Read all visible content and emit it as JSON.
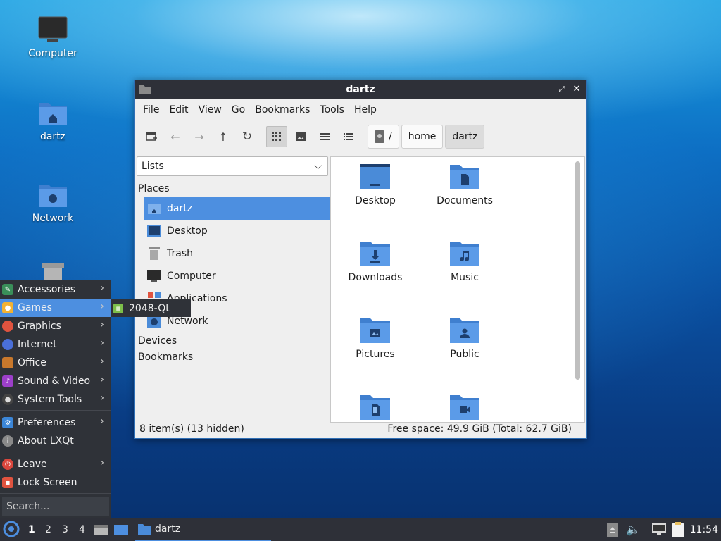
{
  "desktop": {
    "icons": [
      {
        "label": "Computer",
        "icon": "computer-icon"
      },
      {
        "label": "dartz",
        "icon": "home-folder-icon"
      },
      {
        "label": "Network",
        "icon": "network-folder-icon"
      },
      {
        "label": "",
        "icon": "trash-icon"
      }
    ]
  },
  "window": {
    "title": "dartz",
    "menu": [
      "File",
      "Edit",
      "View",
      "Go",
      "Bookmarks",
      "Tools",
      "Help"
    ],
    "breadcrumb": [
      "/",
      "home",
      "dartz"
    ],
    "side_view_select": "Lists",
    "places_header": "Places",
    "places": [
      {
        "label": "dartz",
        "icon": "home-icon",
        "selected": true
      },
      {
        "label": "Desktop",
        "icon": "desktop-icon"
      },
      {
        "label": "Trash",
        "icon": "trash-icon"
      },
      {
        "label": "Computer",
        "icon": "computer-icon"
      },
      {
        "label": "Applications",
        "icon": "applications-icon"
      },
      {
        "label": "Network",
        "icon": "network-icon"
      }
    ],
    "devices_header": "Devices",
    "bookmarks_header": "Bookmarks",
    "files": [
      {
        "label": "Desktop",
        "icon": "desktop-folder-icon"
      },
      {
        "label": "Documents",
        "icon": "documents-folder-icon"
      },
      {
        "label": "Downloads",
        "icon": "downloads-folder-icon"
      },
      {
        "label": "Music",
        "icon": "music-folder-icon"
      },
      {
        "label": "Pictures",
        "icon": "pictures-folder-icon"
      },
      {
        "label": "Public",
        "icon": "public-folder-icon"
      },
      {
        "label": "",
        "icon": "templates-folder-icon"
      },
      {
        "label": "",
        "icon": "videos-folder-icon"
      }
    ],
    "status_left": "8 item(s) (13 hidden)",
    "status_right": "Free space: 49.9 GiB (Total: 62.7 GiB)"
  },
  "start_menu": {
    "items": [
      {
        "label": "Accessories",
        "color": "#3a8f5a"
      },
      {
        "label": "Games",
        "color": "#f2b233",
        "selected": true
      },
      {
        "label": "Graphics",
        "color": "#e0533f"
      },
      {
        "label": "Internet",
        "color": "#4a6fd8"
      },
      {
        "label": "Office",
        "color": "#c8782c"
      },
      {
        "label": "Sound & Video",
        "color": "#9c3fc9"
      },
      {
        "label": "System Tools",
        "color": "#bfbfbf"
      },
      {
        "label": "Preferences",
        "color": "#3b86d8"
      },
      {
        "label": "About LXQt",
        "color": "#8a8a8a"
      },
      {
        "label": "Leave",
        "color": "#d9463c"
      },
      {
        "label": "Lock Screen",
        "color": "#e0533f"
      }
    ],
    "submenu_item": "2048-Qt",
    "search_placeholder": "Search..."
  },
  "taskbar": {
    "desktops": [
      "1",
      "2",
      "3",
      "4"
    ],
    "task_label": "dartz",
    "clock": "11:54"
  },
  "colors": {
    "accent": "#4d8fe0",
    "folder": "#4a8bd8",
    "panel": "#2e3038"
  }
}
